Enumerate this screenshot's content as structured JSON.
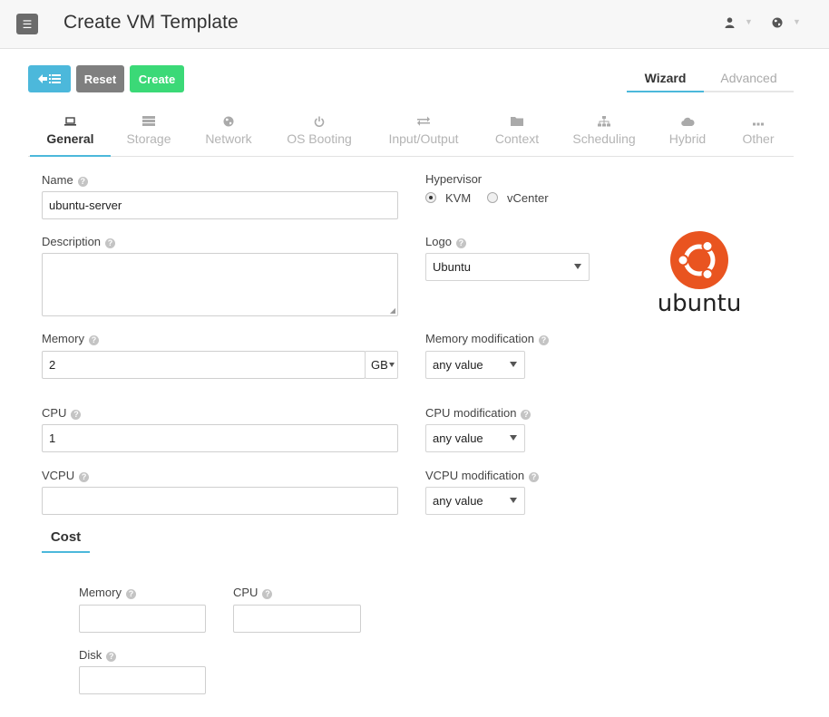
{
  "header": {
    "menu_icon": "hamburger-icon",
    "title": "Create VM Template",
    "user_icon": "user-icon",
    "globe_icon": "globe-icon"
  },
  "toolbar": {
    "back_icon": "back-to-list-icon",
    "reset_label": "Reset",
    "create_label": "Create"
  },
  "mode_tabs": {
    "wizard": "Wizard",
    "advanced": "Advanced"
  },
  "tabs": [
    {
      "label": "General",
      "icon": "laptop-icon"
    },
    {
      "label": "Storage",
      "icon": "storage-icon"
    },
    {
      "label": "Network",
      "icon": "globe-icon"
    },
    {
      "label": "OS Booting",
      "icon": "power-icon"
    },
    {
      "label": "Input/Output",
      "icon": "exchange-icon"
    },
    {
      "label": "Context",
      "icon": "folder-icon"
    },
    {
      "label": "Scheduling",
      "icon": "sitemap-icon"
    },
    {
      "label": "Hybrid",
      "icon": "cloud-icon"
    },
    {
      "label": "Other",
      "icon": "ellipsis-icon"
    }
  ],
  "form": {
    "name_label": "Name",
    "name_value": "ubuntu-server",
    "description_label": "Description",
    "description_value": "",
    "memory_label": "Memory",
    "memory_value": "2",
    "memory_unit": "GB",
    "cpu_label": "CPU",
    "cpu_value": "1",
    "vcpu_label": "VCPU",
    "vcpu_value": "",
    "hypervisor_label": "Hypervisor",
    "hypervisor_options": [
      "KVM",
      "vCenter"
    ],
    "hypervisor_selected": "KVM",
    "logo_label": "Logo",
    "logo_value": "Ubuntu",
    "logo_text": "ubuntu",
    "memory_mod_label": "Memory modification",
    "memory_mod_value": "any value",
    "cpu_mod_label": "CPU modification",
    "cpu_mod_value": "any value",
    "vcpu_mod_label": "VCPU modification",
    "vcpu_mod_value": "any value"
  },
  "cost": {
    "title": "Cost",
    "memory_label": "Memory",
    "memory_value": "",
    "cpu_label": "CPU",
    "cpu_value": "",
    "disk_label": "Disk",
    "disk_value": ""
  },
  "colors": {
    "accent": "#4cb8db",
    "create": "#3bd977",
    "reset": "#7f7f7f",
    "ubuntu_orange": "#e95420"
  }
}
